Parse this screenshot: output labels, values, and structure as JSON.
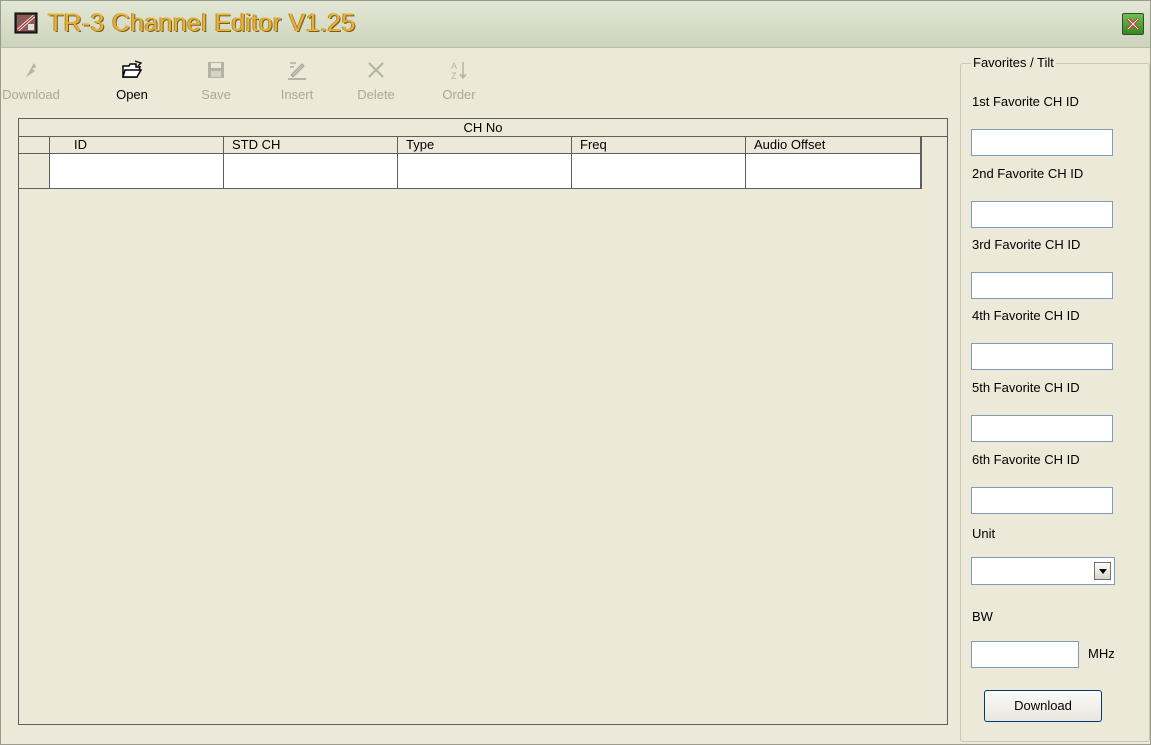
{
  "window": {
    "title": "TR-3 Channel Editor V1.25"
  },
  "toolbar": {
    "buttons": [
      {
        "label": "Download",
        "icon": "download-arrow-icon",
        "enabled": false
      },
      {
        "label": "Open",
        "icon": "open-folder-icon",
        "enabled": true
      },
      {
        "label": "Save",
        "icon": "floppy-disk-icon",
        "enabled": false
      },
      {
        "label": "Insert",
        "icon": "insert-pencil-icon",
        "enabled": false
      },
      {
        "label": "Delete",
        "icon": "delete-x-icon",
        "enabled": false
      },
      {
        "label": "Order",
        "icon": "sort-az-icon",
        "enabled": false
      }
    ]
  },
  "grid": {
    "band_title": "CH No",
    "columns": [
      "ID",
      "STD CH",
      "Type",
      "Freq",
      "Audio Offset"
    ],
    "rows": [
      [
        "",
        "",
        "",
        "",
        ""
      ]
    ]
  },
  "favorites": {
    "group_title": "Favorites / Tilt",
    "labels": [
      "1st Favorite CH  ID",
      "2nd Favorite CH  ID",
      "3rd Favorite CH ID",
      "4th Favorite CH  ID",
      "5th Favorite CH  ID",
      "6th Favorite CH  ID"
    ],
    "values": [
      "",
      "",
      "",
      "",
      "",
      ""
    ],
    "unit_label": "Unit",
    "unit_value": "",
    "bw_label": "BW",
    "bw_value": "",
    "bw_unit": "MHz",
    "download_label": "Download"
  },
  "colors": {
    "background": "#ECE9D8",
    "title_text": "#E6B23B",
    "close_button": "#2f8a22"
  }
}
